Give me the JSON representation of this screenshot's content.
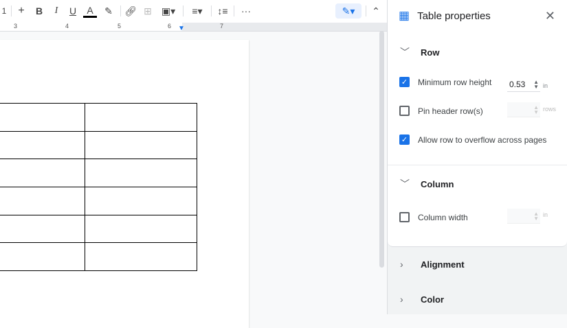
{
  "toolbar": {
    "font_size": "1",
    "plus": "+",
    "bold": "B",
    "italic": "I",
    "underline": "U",
    "text_color": "A",
    "more": "···"
  },
  "ruler": {
    "marks": [
      "3",
      "4",
      "5",
      "6",
      "7"
    ]
  },
  "panel": {
    "title": "Table properties",
    "sections": {
      "row": "Row",
      "column": "Column",
      "alignment": "Alignment",
      "color": "Color"
    },
    "row": {
      "min_height_label": "Minimum row height",
      "min_height_value": "0.53",
      "min_height_unit": "in",
      "min_height_checked": true,
      "pin_header_label": "Pin header row(s)",
      "pin_header_unit": "rows",
      "pin_header_checked": false,
      "overflow_label": "Allow row to overflow across pages",
      "overflow_checked": true
    },
    "column": {
      "width_label": "Column width",
      "width_unit": "in",
      "width_checked": false
    }
  },
  "colors": {
    "accent": "#1a73e8"
  }
}
